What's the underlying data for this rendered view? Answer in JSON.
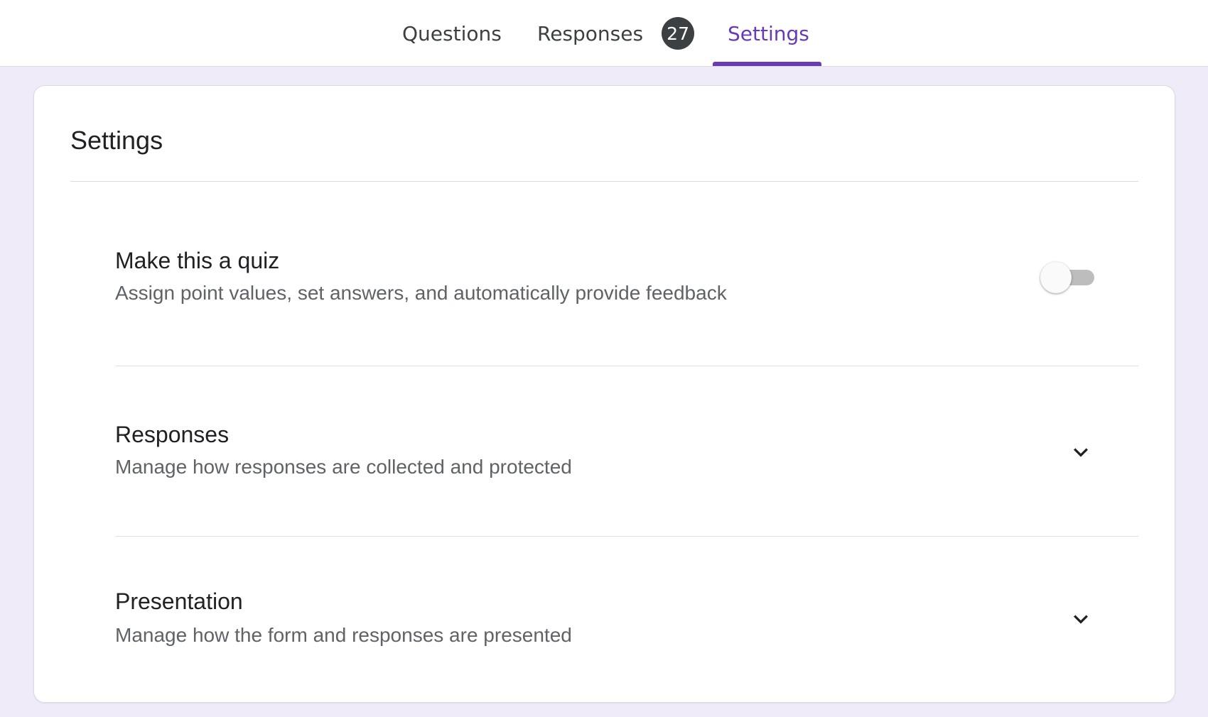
{
  "tabs": {
    "questions": "Questions",
    "responses": "Responses",
    "responses_count": "27",
    "settings": "Settings",
    "active": "settings",
    "accent_color": "#673ab7"
  },
  "card": {
    "title": "Settings",
    "rows": [
      {
        "title": "Make this a quiz",
        "description": "Assign point values, set answers, and automatically provide feedback",
        "control": "toggle",
        "toggle_on": false
      },
      {
        "title": "Responses",
        "description": "Manage how responses are collected and protected",
        "control": "expand",
        "icon": "chevron-down-icon"
      },
      {
        "title": "Presentation",
        "description": "Manage how the form and responses are presented",
        "control": "expand",
        "icon": "chevron-down-icon"
      }
    ]
  }
}
